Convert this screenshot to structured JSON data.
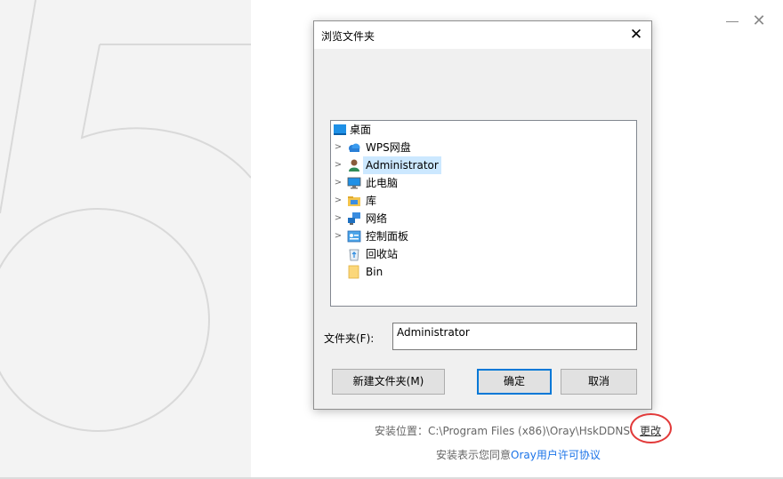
{
  "dialog": {
    "title": "浏览文件夹",
    "folder_label": "文件夹(F):",
    "folder_value": "Administrator",
    "buttons": {
      "new_folder": "新建文件夹(M)",
      "ok": "确定",
      "cancel": "取消"
    },
    "tree": [
      {
        "label": "桌面",
        "icon": "desktop-icon",
        "expandable": false,
        "selected": false
      },
      {
        "label": "WPS网盘",
        "icon": "cloud-icon",
        "expandable": true,
        "selected": false
      },
      {
        "label": "Administrator",
        "icon": "user-icon",
        "expandable": true,
        "selected": true
      },
      {
        "label": "此电脑",
        "icon": "computer-icon",
        "expandable": true,
        "selected": false
      },
      {
        "label": "库",
        "icon": "library-icon",
        "expandable": true,
        "selected": false
      },
      {
        "label": "网络",
        "icon": "network-icon",
        "expandable": true,
        "selected": false
      },
      {
        "label": "控制面板",
        "icon": "control-panel-icon",
        "expandable": true,
        "selected": false
      },
      {
        "label": "回收站",
        "icon": "recycle-bin-icon",
        "expandable": false,
        "selected": false
      },
      {
        "label": "Bin",
        "icon": "folder-icon",
        "expandable": false,
        "selected": false
      }
    ]
  },
  "installer": {
    "install_path": "安装位置：C:\\Program Files (x86)\\Oray\\HskDDNS\\",
    "change_label": "更改",
    "agree_prefix": "安装表示您同意",
    "agree_link": "Oray用户许可协议"
  },
  "window": {
    "close_glyph": "✕",
    "dialog_close_glyph": "✕"
  },
  "colors": {
    "accent": "#0078d7",
    "selection": "#cce8ff",
    "link": "#1a73e8",
    "highlight_circle": "#e23a3a"
  }
}
